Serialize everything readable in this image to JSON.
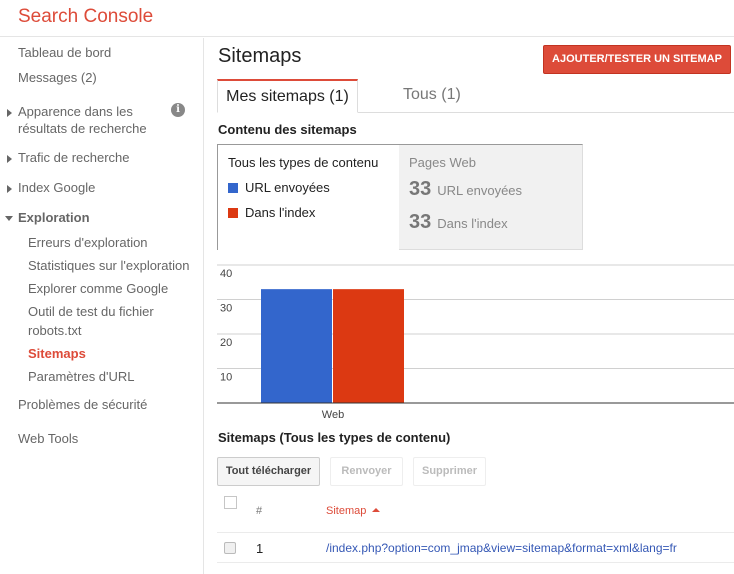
{
  "app": {
    "title": "Search Console"
  },
  "sidebar": {
    "items": [
      {
        "label": "Tableau de bord"
      },
      {
        "label": "Messages (2)"
      },
      {
        "label_line1": "Apparence dans les",
        "label_line2": "résultats de recherche",
        "expandable": true,
        "info_icon": "info-icon"
      },
      {
        "label": "Trafic de recherche",
        "expandable": true
      },
      {
        "label": "Index Google",
        "expandable": true
      },
      {
        "label": "Exploration",
        "expanded": true,
        "children": [
          {
            "label": "Erreurs d'exploration"
          },
          {
            "label": "Statistiques sur l'exploration"
          },
          {
            "label": "Explorer comme Google"
          },
          {
            "label_line1": "Outil de test du fichier",
            "label_line2": "robots.txt"
          },
          {
            "label": "Sitemaps",
            "active": true
          },
          {
            "label": "Paramètres d'URL"
          }
        ]
      },
      {
        "label": "Problèmes de sécurité"
      },
      {
        "label": "Web Tools"
      }
    ]
  },
  "header": {
    "title": "Sitemaps",
    "add_button": "AJOUTER/TESTER UN SITEMAP"
  },
  "tabs": [
    {
      "label": "Mes sitemaps (1)",
      "active": true
    },
    {
      "label": "Tous (1)",
      "active": false
    }
  ],
  "content": {
    "section_title": "Contenu des sitemaps",
    "legend": {
      "heading": "Tous les types de contenu",
      "items": [
        {
          "label": "URL envoyées",
          "color": "#3366cc"
        },
        {
          "label": "Dans l'index",
          "color": "#dc3912"
        }
      ]
    },
    "stats": {
      "heading": "Pages Web",
      "rows": [
        {
          "value": "33",
          "label": "URL envoyées"
        },
        {
          "value": "33",
          "label": "Dans l'index"
        }
      ]
    }
  },
  "chart_data": {
    "type": "bar",
    "categories": [
      "Web"
    ],
    "series": [
      {
        "name": "URL envoyées",
        "values": [
          33
        ],
        "color": "#3366cc"
      },
      {
        "name": "Dans l'index",
        "values": [
          33
        ],
        "color": "#dc3912"
      }
    ],
    "yticks": [
      10,
      20,
      30,
      40
    ],
    "ylim": [
      0,
      40
    ],
    "grid": true,
    "title": "",
    "xlabel": "",
    "ylabel": ""
  },
  "table": {
    "title": "Sitemaps (Tous les types de contenu)",
    "buttons": {
      "download": "Tout télécharger",
      "resubmit": "Renvoyer",
      "delete": "Supprimer"
    },
    "columns": {
      "num": "#",
      "sitemap": "Sitemap"
    },
    "rows": [
      {
        "num": "1",
        "sitemap": "/index.php?option=com_jmap&view=sitemap&format=xml&lang=fr"
      }
    ]
  }
}
